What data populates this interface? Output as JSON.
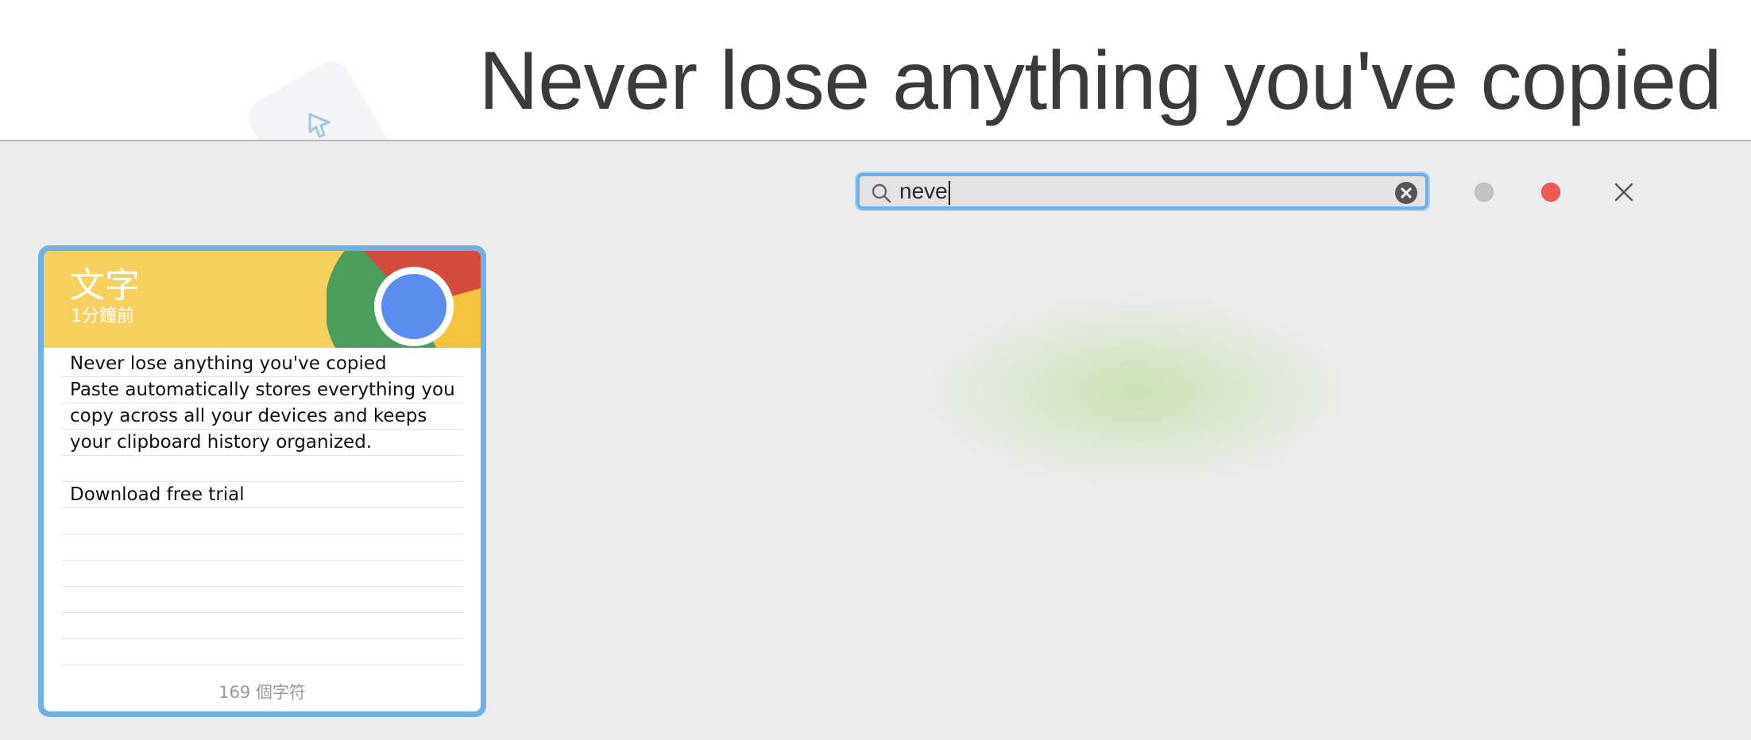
{
  "hero": {
    "title": "Never lose anything you've copied"
  },
  "search": {
    "value": "neve",
    "icon": "search-icon",
    "clear_icon": "clear-circle-icon"
  },
  "window_controls": {
    "minimize_color": "#c4c4c4",
    "close_dot_color": "#ef5a55",
    "close_icon": "close-icon"
  },
  "clip": {
    "type": "文字",
    "time": "1分鐘前",
    "app_icon": "chrome-icon",
    "header_color": "#f7cf5f",
    "selected_border_color": "#6fb1e6",
    "lines": [
      "Never lose anything you've copied",
      "Paste automatically stores everything you",
      "copy across all your devices and keeps",
      "your clipboard history organized.",
      "",
      "Download free trial",
      "",
      "",
      "",
      "",
      "",
      ""
    ],
    "footer": "169 個字符"
  }
}
